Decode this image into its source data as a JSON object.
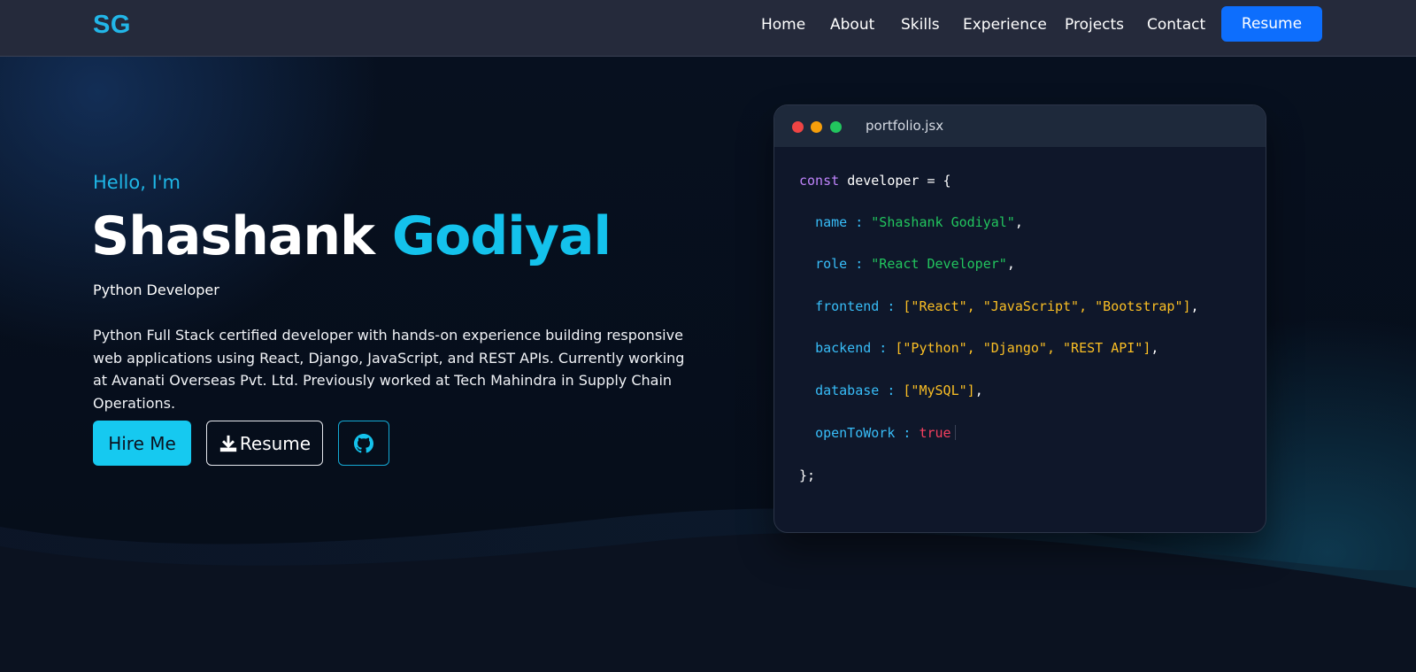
{
  "navbar": {
    "brand": "SG",
    "links": [
      "Home",
      "About",
      "Skills",
      "Experience",
      "Projects",
      "Contact"
    ],
    "resume_label": "Resume"
  },
  "hero": {
    "greeting": "Hello, I'm",
    "first_name": "Shashank",
    "last_name": "Godiyal",
    "role": "Python Developer",
    "bio": "Python Full Stack certified developer with hands-on experience building responsive web applications using React, Django, JavaScript, and REST APIs. Currently working at Avanati Overseas Pvt. Ltd. Previously worked at Tech Mahindra in Supply Chain Operations.",
    "hire_label": "Hire Me",
    "resume_label": "Resume"
  },
  "code_card": {
    "filename": "portfolio.jsx",
    "lines": {
      "decl_kw": "const",
      "decl_name": "developer",
      "decl_tail": " = {",
      "name_key": "name",
      "name_val": "\"Shashank Godiyal\"",
      "role_key": "role",
      "role_val": "\"React Developer\"",
      "frontend_key": "frontend",
      "frontend_val": "[\"React\", \"JavaScript\", \"Bootstrap\"]",
      "backend_key": "backend",
      "backend_val": "[\"Python\", \"Django\", \"REST API\"]",
      "database_key": "database",
      "database_val": "[\"MySQL\"]",
      "open_key": "openToWork",
      "open_val": "true",
      "close": "};"
    }
  },
  "colors": {
    "accent": "#14c2ec",
    "primary_button": "#0d6efd",
    "nav_bg": "#252a3b",
    "hero_bg": "#060d19",
    "card_bg": "#0f172a"
  },
  "icons": [
    "download-icon",
    "github-icon"
  ]
}
